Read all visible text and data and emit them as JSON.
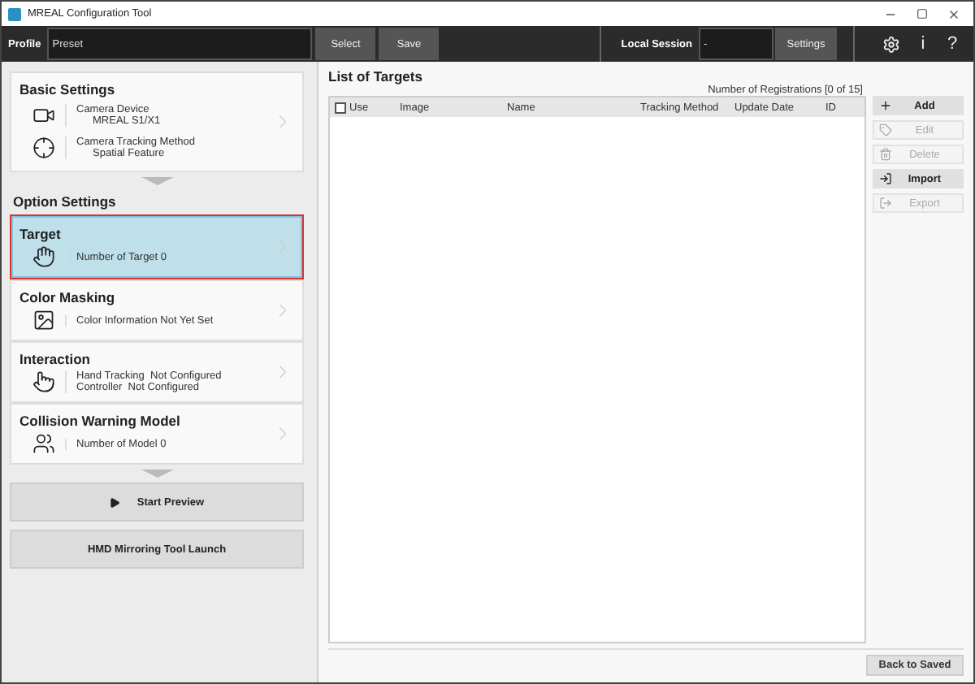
{
  "window": {
    "title": "MREAL Configuration Tool"
  },
  "toolbar": {
    "profile_label": "Profile",
    "profile_value": "Preset",
    "select": "Select",
    "save": "Save",
    "session_label": "Local Session",
    "session_value": "-",
    "settings": "Settings",
    "info": "i",
    "help": "?"
  },
  "basic_settings": {
    "title": "Basic Settings",
    "rows": [
      {
        "label": "Camera Device",
        "value": "MREAL S1/X1"
      },
      {
        "label": "Camera Tracking Method",
        "value": "Spatial Feature"
      }
    ]
  },
  "option_settings": {
    "title": "Option Settings",
    "cards": [
      {
        "title": "Target",
        "lines": [
          "Number of Target 0"
        ],
        "selected": true
      },
      {
        "title": "Color Masking",
        "lines": [
          "Color Information Not Yet Set"
        ],
        "selected": false
      },
      {
        "title": "Interaction",
        "lines": [
          "Hand Tracking  Not Configured",
          "Controller  Not Configured"
        ],
        "selected": false
      },
      {
        "title": "Collision Warning Model",
        "lines": [
          "Number of Model 0"
        ],
        "selected": false
      }
    ]
  },
  "start_preview": "Start Preview",
  "hmd_button": "HMD Mirroring Tool Launch",
  "list": {
    "title": "List of Targets",
    "count": "Number of Registrations [0 of 15]",
    "use_checked": false,
    "columns": [
      "Use",
      "Image",
      "Name",
      "Tracking Method",
      "Update Date",
      "ID"
    ]
  },
  "actions": [
    {
      "label": "Add",
      "disabled": false
    },
    {
      "label": "Edit",
      "disabled": true
    },
    {
      "label": "Delete",
      "disabled": true
    },
    {
      "label": "Import",
      "disabled": false
    },
    {
      "label": "Export",
      "disabled": true
    }
  ],
  "back_button": "Back to Saved"
}
